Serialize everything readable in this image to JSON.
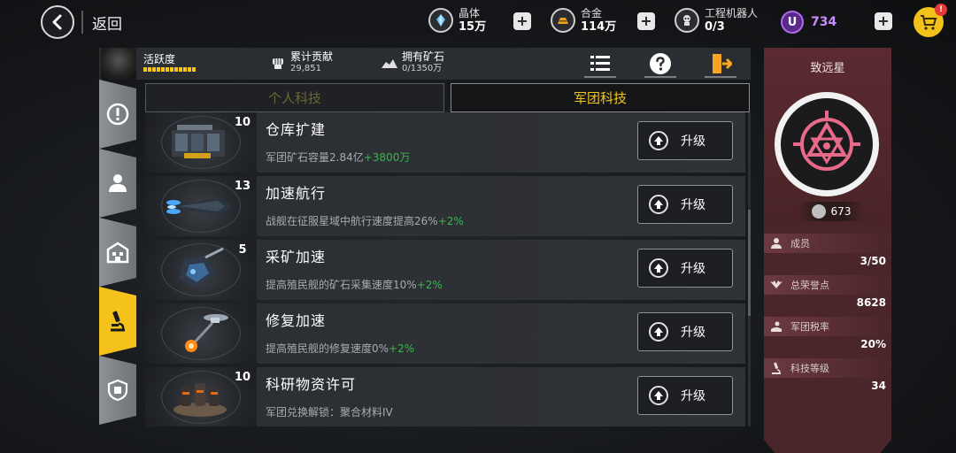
{
  "topbar": {
    "back_label": "返回",
    "crystal": {
      "label": "晶体",
      "value": "15万"
    },
    "alloy": {
      "label": "合金",
      "value": "114万"
    },
    "robots": {
      "label": "工程机器人",
      "value": "0/3"
    },
    "u_icon": "U",
    "u_value": "734",
    "plus": "+",
    "cart_badge": "!"
  },
  "subheader": {
    "activity_label": "活跃度",
    "activity_progress": 1.0,
    "contribution": {
      "label": "累计贡献",
      "value": "29,851"
    },
    "ore": {
      "label": "拥有矿石",
      "value": "0/1350万"
    }
  },
  "tabs": {
    "personal": "个人科技",
    "legion": "军团科技"
  },
  "tech_items": [
    {
      "level": "10",
      "title": "仓库扩建",
      "desc": "军团矿石容量2.84亿",
      "bonus": "+3800万",
      "button": "升级"
    },
    {
      "level": "13",
      "title": "加速航行",
      "desc": "战舰在征服星域中航行速度提高26%",
      "bonus": "+2%",
      "button": "升级"
    },
    {
      "level": "5",
      "title": "采矿加速",
      "desc": "提高殖民舰的矿石采集速度10%",
      "bonus": "+2%",
      "button": "升级"
    },
    {
      "level": "",
      "title": "修复加速",
      "desc": "提高殖民舰的修复速度0%",
      "bonus": "+2%",
      "button": "升级"
    },
    {
      "level": "10",
      "title": "科研物资许可",
      "desc": "军团兑换解锁：聚合材料IV",
      "bonus": "",
      "button": "升级"
    }
  ],
  "legion_panel": {
    "name": "致远星",
    "power": "673",
    "members": {
      "label": "成员",
      "value": "3/50"
    },
    "honor": {
      "label": "总荣誉点",
      "value": "8628"
    },
    "tax": {
      "label": "军团税率",
      "value": "20%"
    },
    "tech_level": {
      "label": "科技等级",
      "value": "34"
    }
  },
  "colors": {
    "accent": "#f5c518",
    "bonus": "#3bb54a",
    "panel": "#4a2529",
    "u_currency": "#c98cff"
  }
}
